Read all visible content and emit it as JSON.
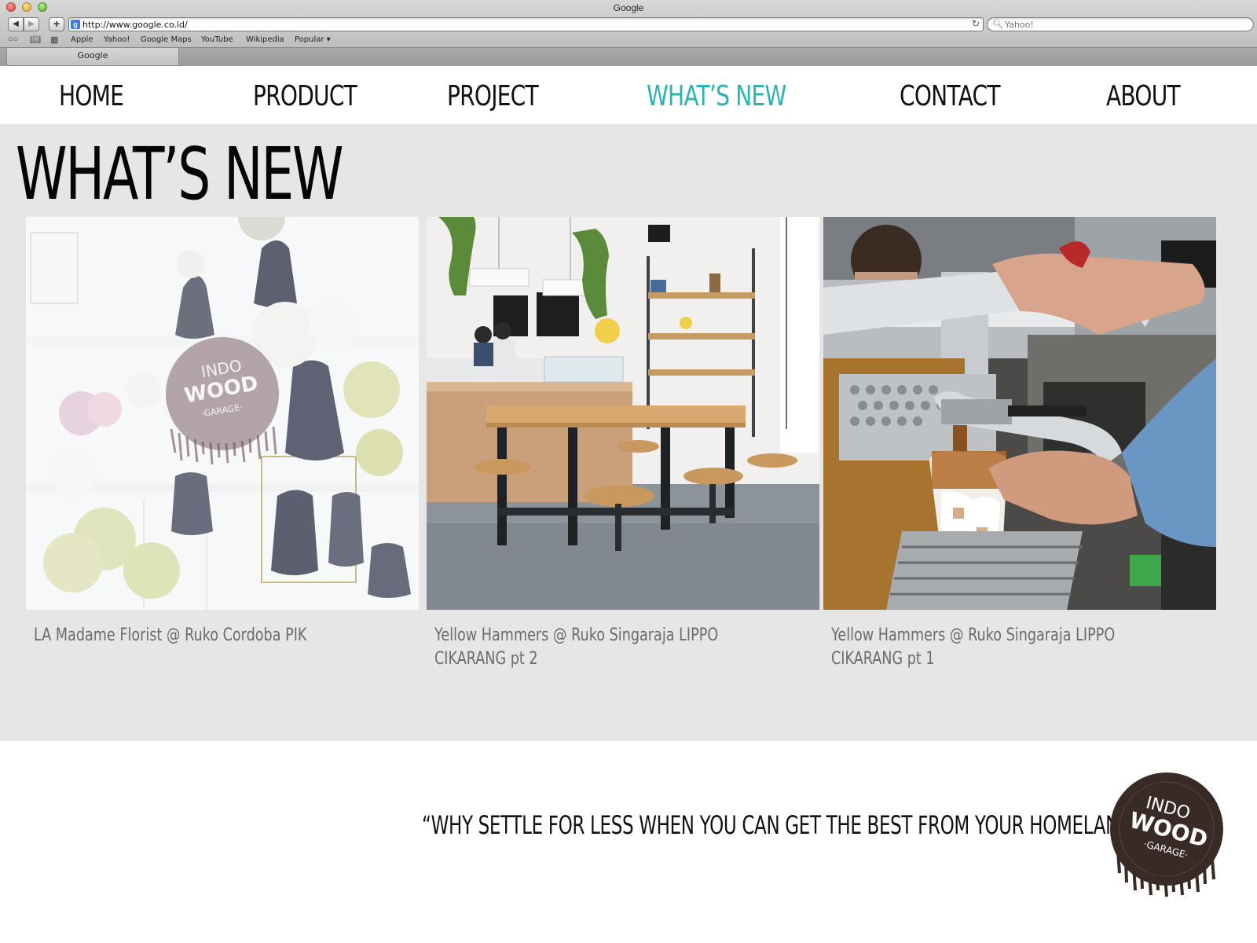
{
  "browser": {
    "window_title": "Google",
    "url": "http://www.google.co.id/",
    "search_placeholder": "Yahoo!",
    "bookmarks": [
      "Apple",
      "Yahoo!",
      "Google Maps",
      "YouTube",
      "Wikipedia",
      "Popular ▾"
    ],
    "tab_label": "Google"
  },
  "nav": {
    "items": [
      {
        "label": "HOME"
      },
      {
        "label": "PRODUCT"
      },
      {
        "label": "PROJECT"
      },
      {
        "label": "WHAT’S NEW",
        "active": true
      },
      {
        "label": "CONTACT"
      },
      {
        "label": "ABOUT"
      }
    ],
    "active_color": "#2bb3b1"
  },
  "page": {
    "title": "WHAT’S NEW"
  },
  "cards": [
    {
      "caption": "LA Madame Florist @ Ruko Cordoba PIK",
      "image": "florist-interior-photo"
    },
    {
      "caption": "Yellow Hammers @ Ruko Singaraja LIPPO CIKARANG pt 2",
      "image": "cafe-interior-photo"
    },
    {
      "caption": "Yellow Hammers @ Ruko Singaraja LIPPO CIKARANG pt 1",
      "image": "espresso-machine-photo"
    }
  ],
  "watermark": {
    "line1": "INDO",
    "line2": "WOOD",
    "line3": "·GARAGE·"
  },
  "footer": {
    "tagline": "“WHY SETTLE FOR LESS WHEN YOU CAN GET THE BEST FROM YOUR HOMELAND”",
    "logo": {
      "line1": "INDO",
      "line2": "WOOD",
      "line3": "·GARAGE·"
    }
  },
  "colors": {
    "content_bg": "#e6e6e6",
    "caption": "#6b6b6b",
    "logo_brown": "#3a2a26"
  }
}
